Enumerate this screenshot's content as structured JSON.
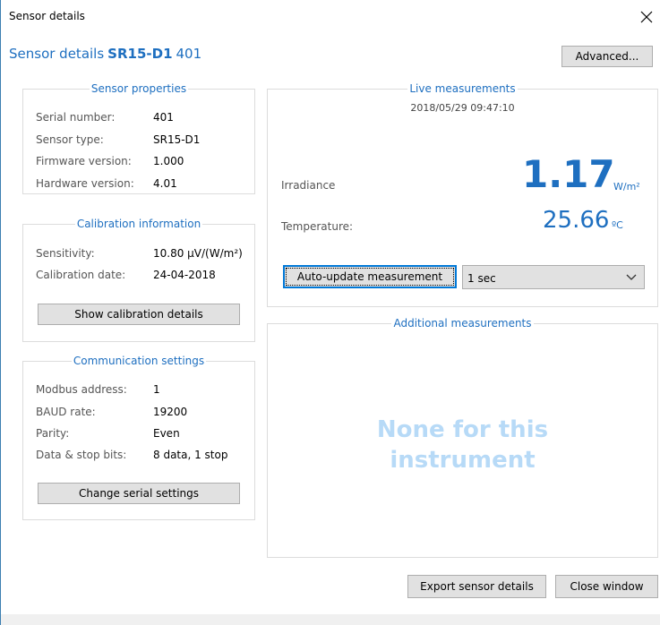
{
  "window": {
    "title": "Sensor details",
    "close_glyph": "✕"
  },
  "header": {
    "prefix": "Sensor details",
    "model": "SR15-D1",
    "serial": "401"
  },
  "buttons": {
    "advanced": "Advanced...",
    "show_calibration": "Show calibration details",
    "change_serial": "Change serial settings",
    "auto_update": "Auto-update measurement",
    "export": "Export sensor details",
    "close": "Close window"
  },
  "sensor_properties": {
    "title": "Sensor properties",
    "rows": [
      {
        "label": "Serial number:",
        "value": "401"
      },
      {
        "label": "Sensor type:",
        "value": "SR15-D1"
      },
      {
        "label": "Firmware version:",
        "value": "1.000"
      },
      {
        "label": "Hardware version:",
        "value": "4.01"
      }
    ]
  },
  "calibration": {
    "title": "Calibration information",
    "rows": [
      {
        "label": "Sensitivity:",
        "value": "10.80 µV/(W/m²)"
      },
      {
        "label": "Calibration date:",
        "value": "24-04-2018"
      }
    ]
  },
  "communication": {
    "title": "Communication settings",
    "rows": [
      {
        "label": "Modbus address:",
        "value": "1"
      },
      {
        "label": "BAUD rate:",
        "value": "19200"
      },
      {
        "label": "Parity:",
        "value": "Even"
      },
      {
        "label": "Data & stop bits:",
        "value": "8 data, 1 stop"
      }
    ]
  },
  "live": {
    "title": "Live measurements",
    "timestamp": "2018/05/29 09:47:10",
    "irradiance_label": "Irradiance",
    "irradiance_value": "1.17",
    "irradiance_unit": "W/m²",
    "temperature_label": "Temperature:",
    "temperature_value": "25.66",
    "temperature_unit": "ºC",
    "interval_selected": "1 sec"
  },
  "additional": {
    "title": "Additional measurements",
    "message_line1": "None for this",
    "message_line2": "instrument"
  },
  "colors": {
    "accent": "#1e6fc0",
    "placeholder_text": "#b7daf7",
    "button_bg": "#e1e1e1",
    "group_border": "#dcdcdc"
  },
  "icons": {
    "close": "close-icon",
    "dropdown": "chevron-down-icon"
  }
}
